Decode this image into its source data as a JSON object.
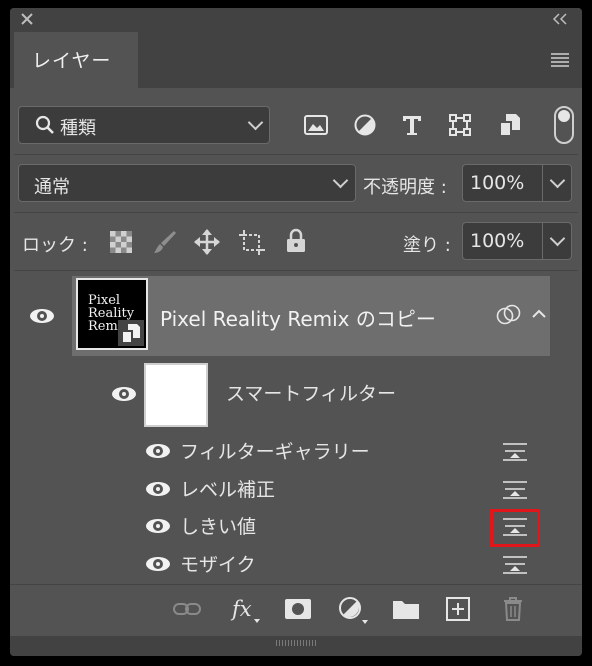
{
  "panel": {
    "tab_label": "レイヤー"
  },
  "filter": {
    "search_label": "種類",
    "icons": [
      "image-filter-icon",
      "adjustment-filter-icon",
      "type-filter-icon",
      "shape-filter-icon",
      "smart-object-filter-icon"
    ]
  },
  "blend": {
    "mode": "通常",
    "opacity_label": "不透明度 :",
    "opacity_value": "100%"
  },
  "lock": {
    "label": "ロック :",
    "fill_label": "塗り :",
    "fill_value": "100%"
  },
  "layers": {
    "main_layer_name": "Pixel Reality Remix のコピー",
    "thumbnail_text": [
      "Pixel",
      "Reality",
      "Remix"
    ],
    "smart_filter_label": "スマートフィルター",
    "filters": [
      "フィルターギャラリー",
      "レベル補正",
      "しきい値",
      "モザイク"
    ]
  },
  "highlight_color": "#e0161a"
}
